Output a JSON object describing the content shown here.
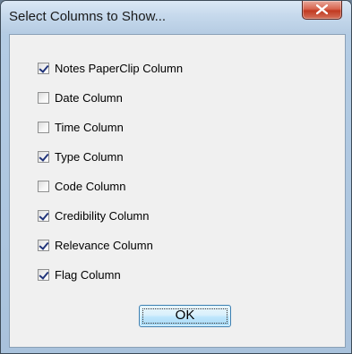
{
  "window": {
    "title": "Select Columns to Show...",
    "close_icon": "close-icon"
  },
  "options": [
    {
      "label": "Notes PaperClip Column",
      "checked": true
    },
    {
      "label": "Date Column",
      "checked": false
    },
    {
      "label": "Time Column",
      "checked": false
    },
    {
      "label": "Type Column",
      "checked": true
    },
    {
      "label": "Code Column",
      "checked": false
    },
    {
      "label": "Credibility Column",
      "checked": true
    },
    {
      "label": "Relevance Column",
      "checked": true
    },
    {
      "label": "Flag Column",
      "checked": true
    }
  ],
  "buttons": {
    "ok_label": "OK"
  },
  "colors": {
    "close_button": "#c13a21",
    "check_mark": "#21347a",
    "ok_border": "#3c7fb1"
  }
}
